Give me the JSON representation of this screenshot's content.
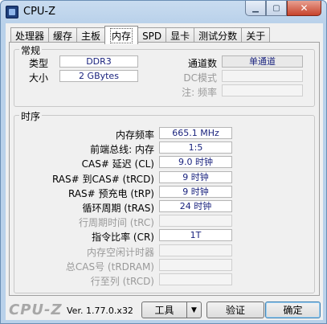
{
  "window": {
    "title": "CPU-Z",
    "min_glyph": "▁",
    "max_glyph": "▢",
    "close_glyph": "✕"
  },
  "tabs": [
    "处理器",
    "缓存",
    "主板",
    "内存",
    "SPD",
    "显卡",
    "测试分数",
    "关于"
  ],
  "active_tab": "内存",
  "general": {
    "group_label": "常规",
    "type_label": "类型",
    "type_value": "DDR3",
    "size_label": "大小",
    "size_value": "2 GBytes",
    "channel_label": "通道数",
    "channel_value": "单通道",
    "dc_mode_label": "DC模式",
    "note_freq_label": "注: 频率"
  },
  "timings": {
    "group_label": "时序",
    "rows": [
      {
        "label": "内存频率",
        "value": "665.1 MHz",
        "disabled": false
      },
      {
        "label": "前端总线: 内存",
        "value": "1:5",
        "disabled": false
      },
      {
        "label": "CAS# 延迟 (CL)",
        "value": "9.0 时钟",
        "disabled": false
      },
      {
        "label": "RAS# 到CAS# (tRCD)",
        "value": "9 时钟",
        "disabled": false
      },
      {
        "label": "RAS# 预充电 (tRP)",
        "value": "9 时钟",
        "disabled": false
      },
      {
        "label": "循环周期 (tRAS)",
        "value": "24 时钟",
        "disabled": false
      },
      {
        "label": "行周期时间 (tRC)",
        "value": "",
        "disabled": true
      },
      {
        "label": "指令比率 (CR)",
        "value": "1T",
        "disabled": false
      },
      {
        "label": "内存空闲计时器",
        "value": "",
        "disabled": true
      },
      {
        "label": "总CAS号 (tRDRAM)",
        "value": "",
        "disabled": true
      },
      {
        "label": "行至列 (tRCD)",
        "value": "",
        "disabled": true
      }
    ]
  },
  "footer": {
    "logo": "CPU-Z",
    "version": "Ver. 1.77.0.x32",
    "tools_label": "工具",
    "dropdown_glyph": "▼",
    "validate_label": "验证",
    "ok_label": "确定"
  }
}
